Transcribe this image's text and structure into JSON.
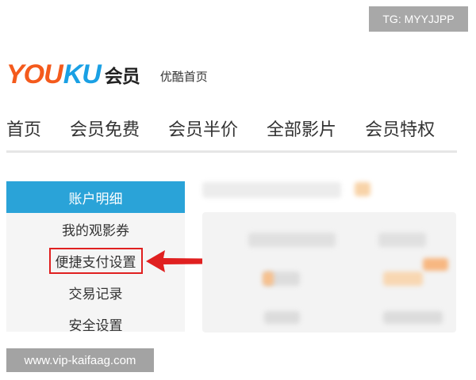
{
  "watermarks": {
    "top": "TG: MYYJJPP",
    "bottom": "www.vip-kaifaag.com"
  },
  "header": {
    "logo_you": "YOU",
    "logo_ku": "KU",
    "logo_vip": "会员",
    "home_link": "优酷首页"
  },
  "nav": {
    "items": [
      "首页",
      "会员免费",
      "会员半价",
      "全部影片",
      "会员特权"
    ]
  },
  "sidebar": {
    "title": "账户明细",
    "items": [
      "我的观影券",
      "便捷支付设置",
      "交易记录",
      "安全设置"
    ]
  },
  "colors": {
    "accent_blue": "#2aa3d8",
    "logo_orange": "#f45a1c",
    "logo_blue": "#1aa0e4",
    "highlight_red": "#e02020"
  }
}
